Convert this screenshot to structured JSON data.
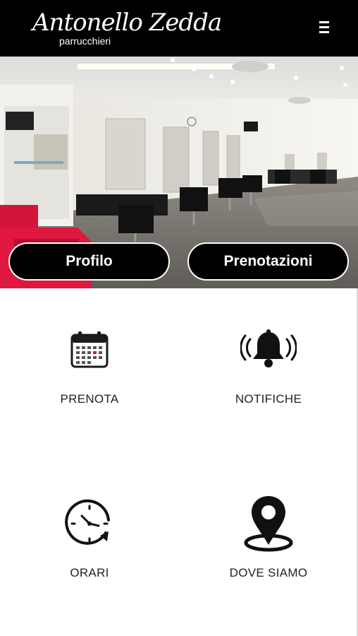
{
  "header": {
    "logo_script": "Antonello Zedda",
    "logo_sub": "parrucchieri",
    "menu_icon": "hamburger-menu-icon"
  },
  "hero": {
    "image": "salon-interior-photo",
    "profilo_label": "Profilo",
    "prenotazioni_label": "Prenotazioni"
  },
  "tiles": [
    {
      "label": "PRENOTA",
      "icon": "calendar-icon"
    },
    {
      "label": "NOTIFICHE",
      "icon": "bell-ringing-icon"
    },
    {
      "label": "ORARI",
      "icon": "clock-icon"
    },
    {
      "label": "DOVE SIAMO",
      "icon": "map-pin-icon"
    }
  ],
  "colors": {
    "header_bg": "#000000",
    "button_bg": "#000000",
    "button_border": "#ffffff",
    "tile_text": "#222222",
    "page_bg": "#ffffff"
  }
}
